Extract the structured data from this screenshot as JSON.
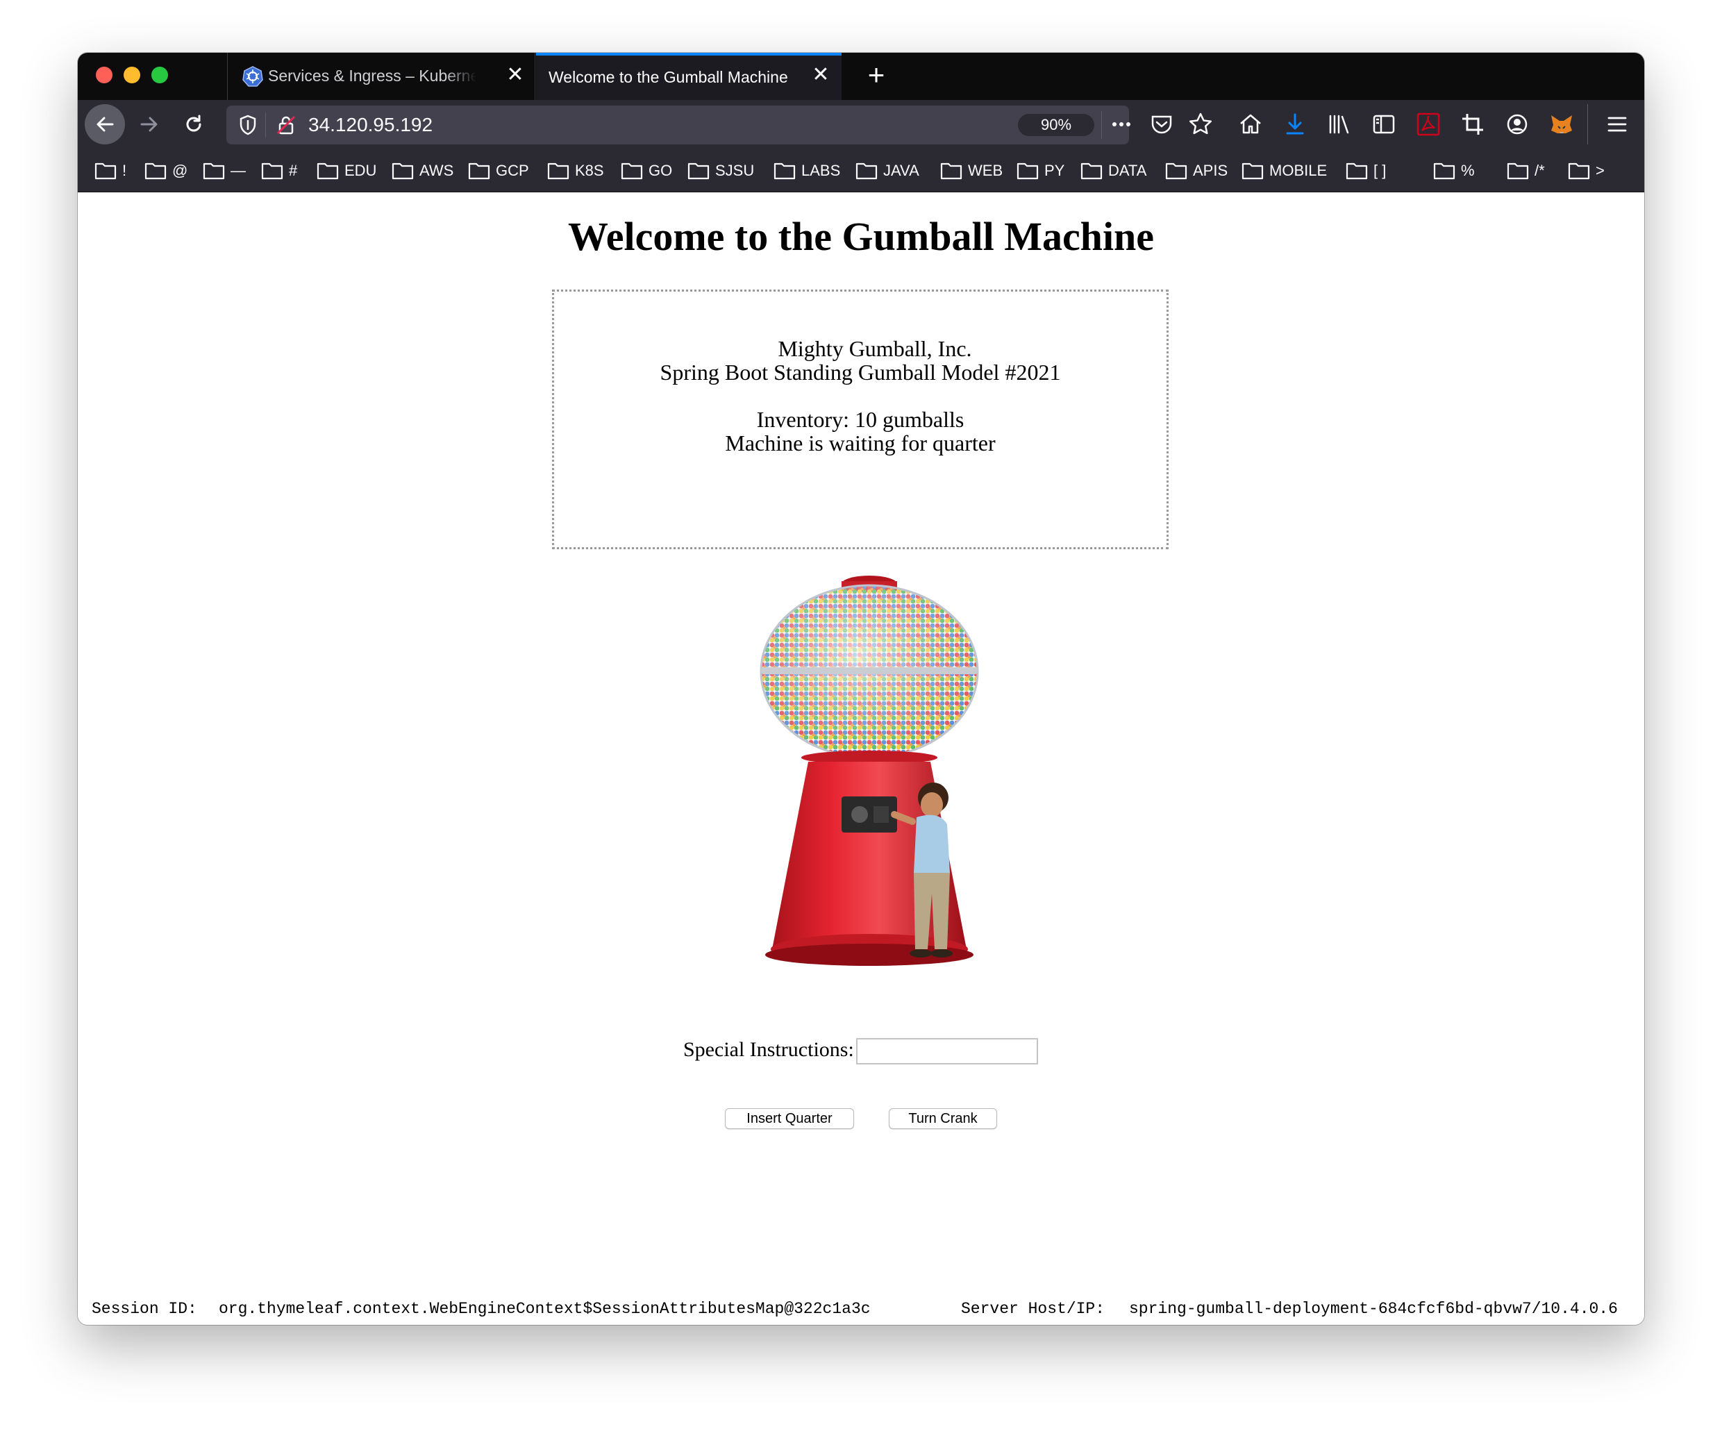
{
  "browser": {
    "tabs": [
      {
        "label": "Services & Ingress – Kubernetes Engine",
        "active": false,
        "icon": "kubernetes-icon"
      },
      {
        "label": "Welcome to the Gumball Machine",
        "active": true
      }
    ],
    "url": "34.120.95.192",
    "zoom": "90%",
    "bookmarks": [
      "!",
      "@",
      "—",
      "#",
      "EDU",
      "AWS",
      "GCP",
      "K8S",
      "GO",
      "SJSU",
      "LABS",
      "JAVA",
      "WEB",
      "PY",
      "DATA",
      "APIS",
      "MOBILE",
      "[ ]",
      "%",
      "/*",
      ">"
    ],
    "accent_color": "#0a84ff"
  },
  "page": {
    "title": "Welcome to the Gumball Machine",
    "info": {
      "company": "Mighty Gumball, Inc.",
      "model": "Spring Boot Standing Gumball Model #2021",
      "inventory": "Inventory: 10 gumballs",
      "state": "Machine is waiting for quarter"
    },
    "instructions_label": "Special Instructions:",
    "instructions_value": "",
    "buttons": {
      "insert_quarter": "Insert Quarter",
      "turn_crank": "Turn Crank"
    },
    "footer": {
      "session_label": "Session ID:",
      "session_value": "org.thymeleaf.context.WebEngineContext$SessionAttributesMap@322c1a3c",
      "server_label": "Server Host/IP:",
      "server_value": "spring-gumball-deployment-684cfcf6bd-qbvw7/10.4.0.6"
    }
  }
}
